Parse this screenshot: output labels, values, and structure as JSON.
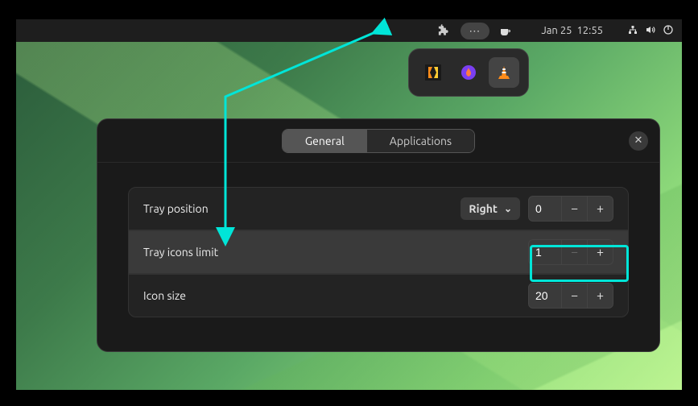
{
  "topbar": {
    "tray_overflow": "⋯",
    "date": "Jan 25",
    "time": "12:55"
  },
  "tray_popup": {
    "items": [
      "app-icon-1",
      "app-icon-2",
      "vlc-icon"
    ]
  },
  "settings": {
    "tabs": {
      "general": "General",
      "applications": "Applications"
    },
    "rows": {
      "tray_position": {
        "label": "Tray position",
        "dropdown": "Right",
        "value": "0"
      },
      "tray_icons_limit": {
        "label": "Tray icons limit",
        "value": "1"
      },
      "icon_size": {
        "label": "Icon size",
        "value": "20"
      }
    }
  },
  "glyphs": {
    "puzzle": "🧩",
    "coffee": "☕",
    "chevron_down": "⌄",
    "minus": "−",
    "plus": "+",
    "close": "✕",
    "network": "▲",
    "volume": "🔊",
    "power": "⏻"
  }
}
